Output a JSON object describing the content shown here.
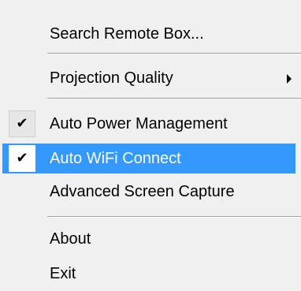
{
  "menu": {
    "search_remote_box": "Search Remote Box...",
    "projection_quality": "Projection Quality",
    "auto_power_management": "Auto Power Management",
    "auto_wifi_connect": "Auto WiFi Connect",
    "advanced_screen_capture": "Advanced Screen Capture",
    "about": "About",
    "exit": "Exit",
    "checkmark_glyph": "✔",
    "highlight_color": "#3399ff",
    "background_color": "#f0f0f0"
  }
}
